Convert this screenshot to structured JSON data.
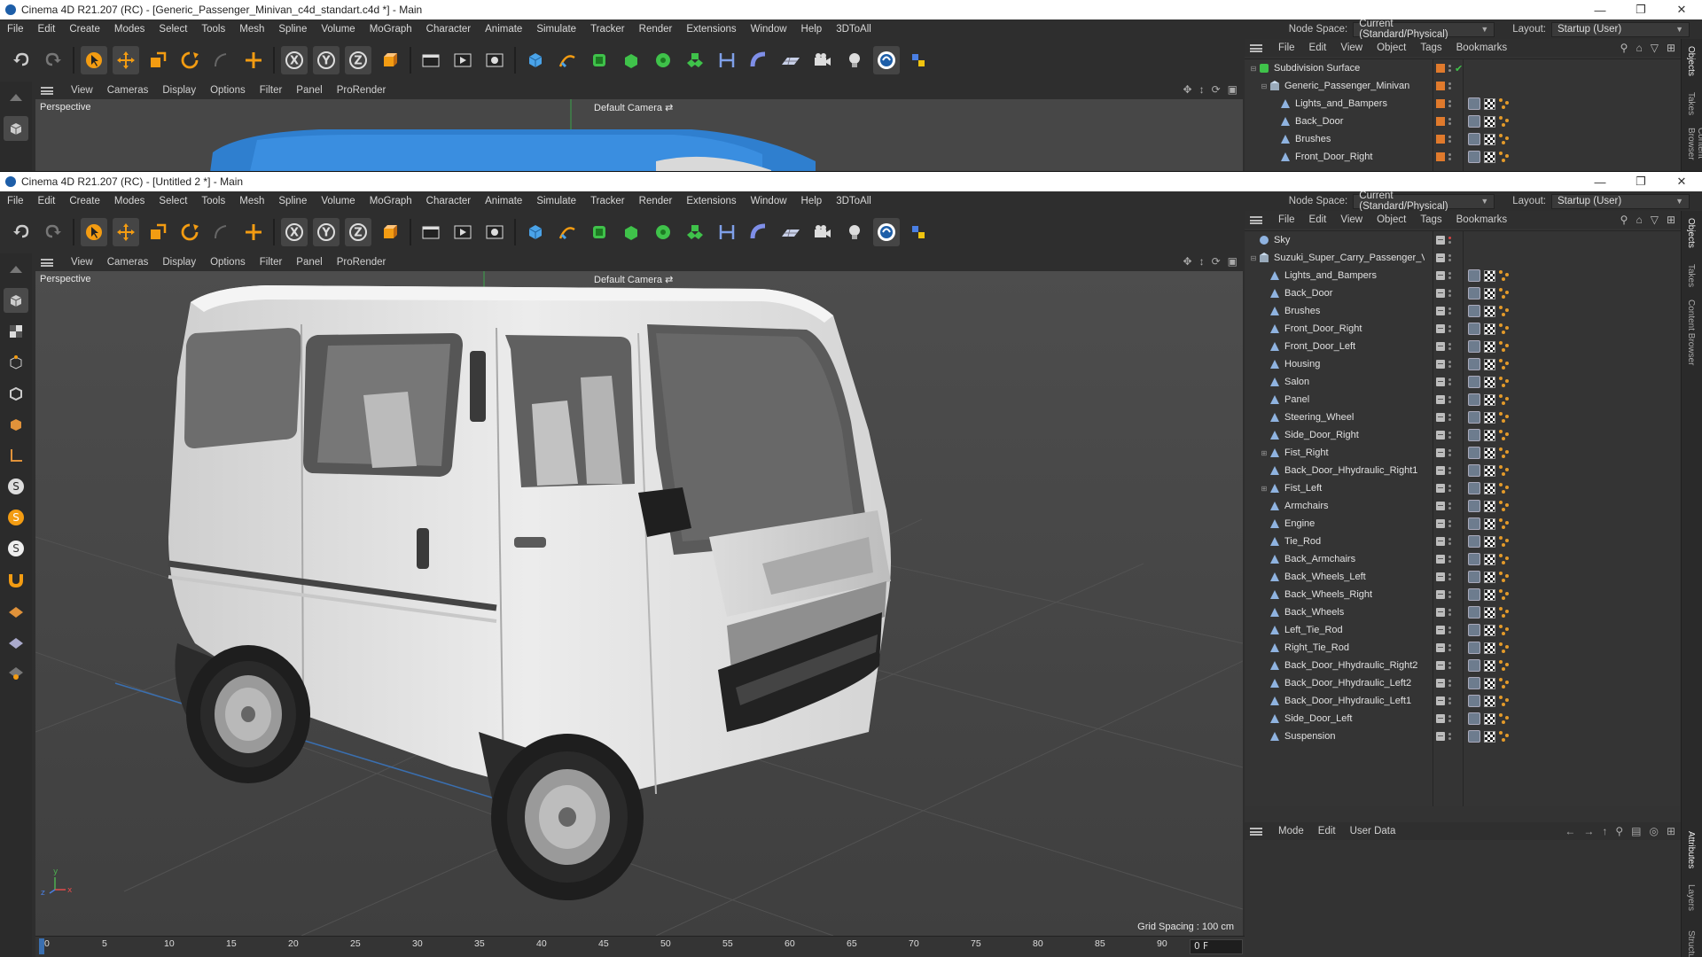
{
  "back_window": {
    "title": "Cinema 4D R21.207 (RC) - [Generic_Passenger_Minivan_c4d_standart.c4d *] - Main",
    "viewport_label": "Perspective",
    "camera_label": "Default Camera",
    "objects": [
      {
        "name": "Subdivision Surface",
        "indent": 0,
        "expand": "-",
        "icon": "subdiv"
      },
      {
        "name": "Generic_Passenger_Minivan",
        "indent": 1,
        "expand": "-",
        "icon": "null"
      },
      {
        "name": "Lights_and_Bampers",
        "indent": 2,
        "expand": "",
        "icon": "poly"
      },
      {
        "name": "Back_Door",
        "indent": 2,
        "expand": "",
        "icon": "poly"
      },
      {
        "name": "Brushes",
        "indent": 2,
        "expand": "",
        "icon": "poly"
      },
      {
        "name": "Front_Door_Right",
        "indent": 2,
        "expand": "",
        "icon": "poly"
      }
    ]
  },
  "front_window": {
    "title": "Cinema 4D R21.207 (RC) - [Untitled 2 *] - Main",
    "viewport_label": "Perspective",
    "camera_label": "Default Camera",
    "grid_spacing": "Grid Spacing : 100 cm",
    "frame_field": "0 F",
    "objects": [
      {
        "name": "Sky",
        "indent": 0,
        "expand": "",
        "icon": "sky"
      },
      {
        "name": "Suzuki_Super_Carry_Passenger_Van",
        "indent": 0,
        "expand": "-",
        "icon": "null"
      },
      {
        "name": "Lights_and_Bampers",
        "indent": 1,
        "expand": "",
        "icon": "poly"
      },
      {
        "name": "Back_Door",
        "indent": 1,
        "expand": "",
        "icon": "poly"
      },
      {
        "name": "Brushes",
        "indent": 1,
        "expand": "",
        "icon": "poly"
      },
      {
        "name": "Front_Door_Right",
        "indent": 1,
        "expand": "",
        "icon": "poly"
      },
      {
        "name": "Front_Door_Left",
        "indent": 1,
        "expand": "",
        "icon": "poly"
      },
      {
        "name": "Housing",
        "indent": 1,
        "expand": "",
        "icon": "poly"
      },
      {
        "name": "Salon",
        "indent": 1,
        "expand": "",
        "icon": "poly"
      },
      {
        "name": "Panel",
        "indent": 1,
        "expand": "",
        "icon": "poly"
      },
      {
        "name": "Steering_Wheel",
        "indent": 1,
        "expand": "",
        "icon": "poly"
      },
      {
        "name": "Side_Door_Right",
        "indent": 1,
        "expand": "",
        "icon": "poly"
      },
      {
        "name": "Fist_Right",
        "indent": 1,
        "expand": "+",
        "icon": "poly"
      },
      {
        "name": "Back_Door_Hhydraulic_Right1",
        "indent": 1,
        "expand": "",
        "icon": "poly"
      },
      {
        "name": "Fist_Left",
        "indent": 1,
        "expand": "+",
        "icon": "poly"
      },
      {
        "name": "Armchairs",
        "indent": 1,
        "expand": "",
        "icon": "poly"
      },
      {
        "name": "Engine",
        "indent": 1,
        "expand": "",
        "icon": "poly"
      },
      {
        "name": "Tie_Rod",
        "indent": 1,
        "expand": "",
        "icon": "poly"
      },
      {
        "name": "Back_Armchairs",
        "indent": 1,
        "expand": "",
        "icon": "poly"
      },
      {
        "name": "Back_Wheels_Left",
        "indent": 1,
        "expand": "",
        "icon": "poly"
      },
      {
        "name": "Back_Wheels_Right",
        "indent": 1,
        "expand": "",
        "icon": "poly"
      },
      {
        "name": "Back_Wheels",
        "indent": 1,
        "expand": "",
        "icon": "poly"
      },
      {
        "name": "Left_Tie_Rod",
        "indent": 1,
        "expand": "",
        "icon": "poly"
      },
      {
        "name": "Right_Tie_Rod",
        "indent": 1,
        "expand": "",
        "icon": "poly"
      },
      {
        "name": "Back_Door_Hhydraulic_Right2",
        "indent": 1,
        "expand": "",
        "icon": "poly"
      },
      {
        "name": "Back_Door_Hhydraulic_Left2",
        "indent": 1,
        "expand": "",
        "icon": "poly"
      },
      {
        "name": "Back_Door_Hhydraulic_Left1",
        "indent": 1,
        "expand": "",
        "icon": "poly"
      },
      {
        "name": "Side_Door_Left",
        "indent": 1,
        "expand": "",
        "icon": "poly"
      },
      {
        "name": "Suspension",
        "indent": 1,
        "expand": "",
        "icon": "poly"
      }
    ],
    "timeline_ticks": [
      "0",
      "5",
      "10",
      "15",
      "20",
      "25",
      "30",
      "35",
      "40",
      "45",
      "50",
      "55",
      "60",
      "65",
      "70",
      "75",
      "80",
      "85",
      "90"
    ]
  },
  "menus": {
    "main": [
      "File",
      "Edit",
      "Create",
      "Modes",
      "Select",
      "Tools",
      "Mesh",
      "Spline",
      "Volume",
      "MoGraph",
      "Character",
      "Animate",
      "Simulate",
      "Tracker",
      "Render",
      "Extensions",
      "Window",
      "Help",
      "3DToAll"
    ],
    "node_space_label": "Node Space:",
    "node_space_value": "Current (Standard/Physical)",
    "layout_label": "Layout:",
    "layout_value": "Startup (User)",
    "viewport": [
      "View",
      "Cameras",
      "Display",
      "Options",
      "Filter",
      "Panel",
      "ProRender"
    ],
    "objects": [
      "File",
      "Edit",
      "View",
      "Object",
      "Tags",
      "Bookmarks"
    ],
    "attributes": [
      "Mode",
      "Edit",
      "User Data"
    ]
  },
  "side_tabs": {
    "top": [
      "Objects",
      "Takes",
      "Content Browser"
    ],
    "bottom": [
      "Attributes",
      "Layers",
      "Structure"
    ]
  },
  "colors": {
    "accent_orange": "#f39c12",
    "layer_orange": "#e07a2c",
    "van_body": "#e6e6e6",
    "viewport_bg": "#4a4a4a"
  }
}
